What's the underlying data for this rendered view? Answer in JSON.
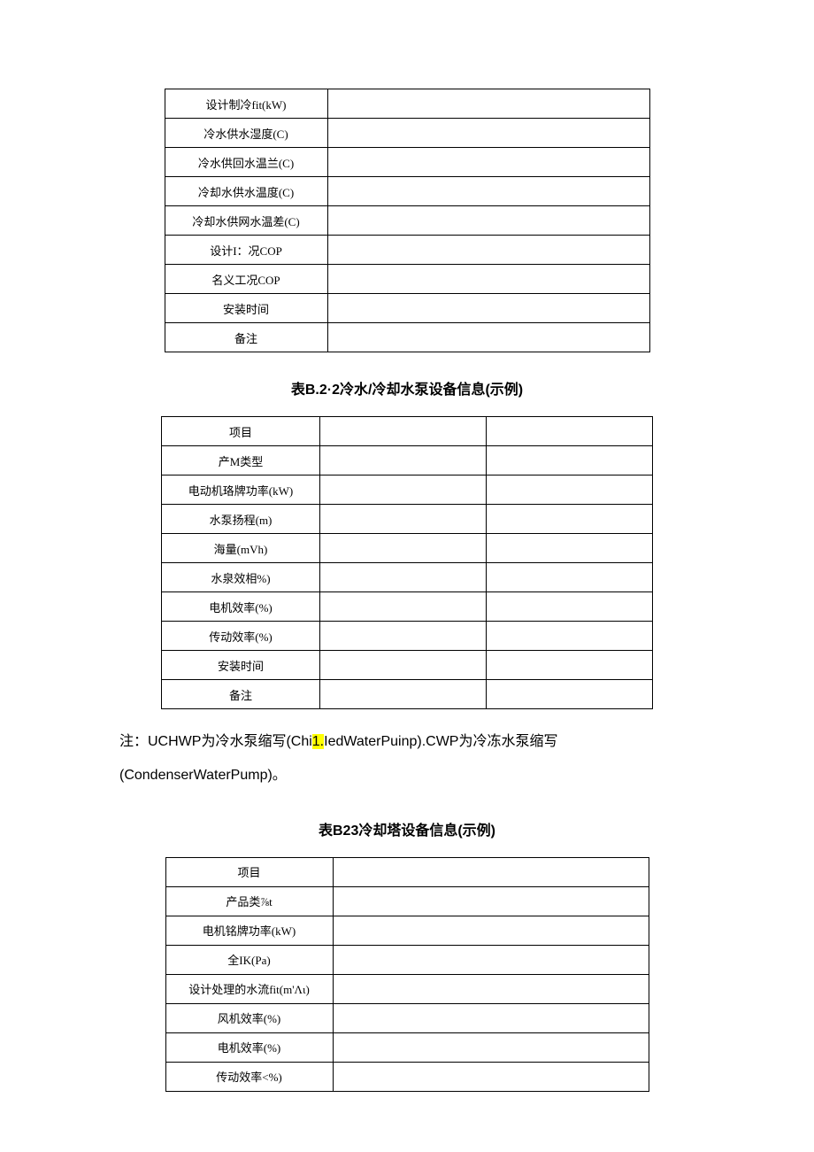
{
  "table1": {
    "rows": [
      "设计制冷fit(kW)",
      "冷水供水湿度(C)",
      "冷水供回水温兰(C)",
      "冷却水供水温度(C)",
      "冷却水供网水温差(C)",
      "设计I：况COP",
      "名义工况COP",
      "安装时间",
      "备注"
    ]
  },
  "caption2": "表B.2·2冷水/冷却水泵设备信息(示例)",
  "table2": {
    "rows": [
      "项目",
      "产M类型",
      "电动机珞牌功率(kW)",
      "水泵扬程(m)",
      "海量(mVh)",
      "水泉效相%)",
      "电机效率(%)",
      "传动效率(%)",
      "安装时间",
      "备注"
    ]
  },
  "note": {
    "prefix": "注：UCHWP为冷水泵缩写(Chi",
    "hl": "1.",
    "mid": "IedWaterPuinp).CWP为冷冻水泵缩写",
    "line2": "(CondenserWaterPump)。"
  },
  "caption3": "表B23冷却塔设备信息(示例)",
  "table3": {
    "rows": [
      "项目",
      "产品类⅞t",
      "电机铭牌功率(kW)",
      "全IK(Pa)",
      "设计处理的水流fit(m'Λι)",
      "风机效率(%)",
      "电机效率(%)",
      "传动效率<%)"
    ]
  },
  "bold_rows_t1": [
    0,
    1,
    2,
    3,
    4,
    5,
    6
  ],
  "bold_rows_t2": [
    1,
    2,
    3,
    4
  ],
  "bold_rows_t3": [
    2,
    3,
    4
  ]
}
